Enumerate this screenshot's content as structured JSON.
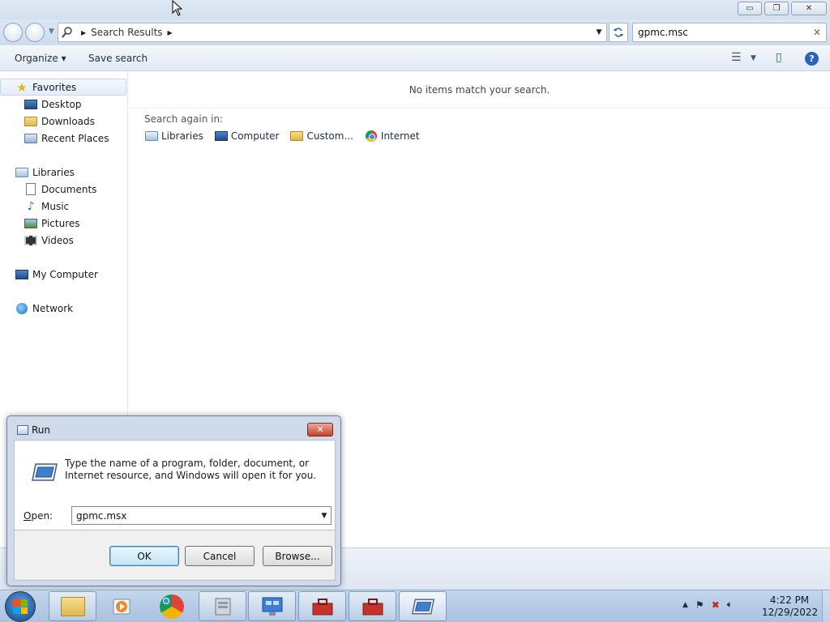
{
  "window": {
    "controls": {
      "minimize": "▭",
      "maximize": "❐",
      "close": "✕"
    }
  },
  "address": {
    "crumb": "Search Results",
    "search_value": "gpmc.msc"
  },
  "toolbar": {
    "organize": "Organize ▾",
    "save_search": "Save search",
    "help": "?"
  },
  "navpane": {
    "favorites": "Favorites",
    "desktop": "Desktop",
    "downloads": "Downloads",
    "recent_places": "Recent Places",
    "libraries": "Libraries",
    "documents": "Documents",
    "music": "Music",
    "pictures": "Pictures",
    "videos": "Videos",
    "my_computer": "My Computer",
    "network": "Network"
  },
  "content": {
    "empty_message": "No items match your search.",
    "search_again_label": "Search again in:",
    "search_again": {
      "libraries": "Libraries",
      "computer": "Computer",
      "custom": "Custom...",
      "internet": "Internet"
    }
  },
  "run_dialog": {
    "title": "Run",
    "description": "Type the name of a program, folder, document, or Internet resource, and Windows will open it for you.",
    "open_label_first": "O",
    "open_label_rest": "pen:",
    "open_value": "gpmc.msx",
    "ok": "OK",
    "cancel": "Cancel",
    "browse": "Browse..."
  },
  "taskbar": {
    "clock_time": "4:22 PM",
    "clock_date": "12/29/2022"
  },
  "icons": {
    "favorites": "star-icon",
    "search_clear": "close-icon",
    "tray_arrow": "chevron-up-icon"
  }
}
